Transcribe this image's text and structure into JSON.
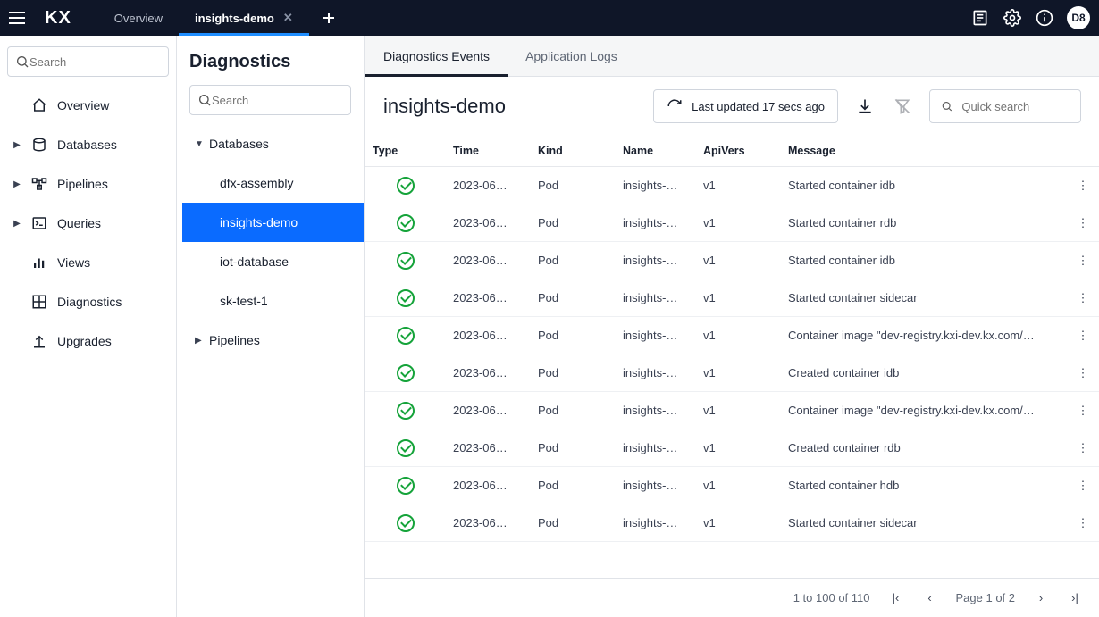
{
  "nav": {
    "logo": "KX",
    "tabs": [
      {
        "label": "Overview",
        "active": false,
        "closable": false
      },
      {
        "label": "insights-demo",
        "active": true,
        "closable": true
      }
    ],
    "avatar": "D8"
  },
  "sidebar": {
    "search_placeholder": "Search",
    "items": [
      {
        "label": "Overview",
        "icon": "home",
        "expandable": false
      },
      {
        "label": "Databases",
        "icon": "disk",
        "expandable": true
      },
      {
        "label": "Pipelines",
        "icon": "flow",
        "expandable": true
      },
      {
        "label": "Queries",
        "icon": "terminal",
        "expandable": true
      },
      {
        "label": "Views",
        "icon": "chart",
        "expandable": false
      },
      {
        "label": "Diagnostics",
        "icon": "grid",
        "expandable": false
      },
      {
        "label": "Upgrades",
        "icon": "upload",
        "expandable": false
      }
    ]
  },
  "panel": {
    "title": "Diagnostics",
    "search_placeholder": "Search",
    "tree": [
      {
        "label": "Databases",
        "type": "group",
        "expanded": true
      },
      {
        "label": "dfx-assembly",
        "type": "child"
      },
      {
        "label": "insights-demo",
        "type": "child",
        "selected": true
      },
      {
        "label": "iot-database",
        "type": "child"
      },
      {
        "label": "sk-test-1",
        "type": "child"
      },
      {
        "label": "Pipelines",
        "type": "group",
        "expanded": false
      }
    ]
  },
  "content": {
    "subtabs": [
      {
        "label": "Diagnostics Events",
        "active": true
      },
      {
        "label": "Application Logs",
        "active": false
      }
    ],
    "title": "insights-demo",
    "refresh_label": "Last updated 17 secs ago",
    "quicksearch_placeholder": "Quick search",
    "columns": [
      "Type",
      "Time",
      "Kind",
      "Name",
      "ApiVers",
      "Message"
    ],
    "rows": [
      {
        "time": "2023-06…",
        "kind": "Pod",
        "name": "insights-…",
        "api": "v1",
        "msg": "Started container idb"
      },
      {
        "time": "2023-06…",
        "kind": "Pod",
        "name": "insights-…",
        "api": "v1",
        "msg": "Started container rdb"
      },
      {
        "time": "2023-06…",
        "kind": "Pod",
        "name": "insights-…",
        "api": "v1",
        "msg": "Started container idb"
      },
      {
        "time": "2023-06…",
        "kind": "Pod",
        "name": "insights-…",
        "api": "v1",
        "msg": "Started container sidecar"
      },
      {
        "time": "2023-06…",
        "kind": "Pod",
        "name": "insights-…",
        "api": "v1",
        "msg": "Container image \"dev-registry.kxi-dev.kx.com/…"
      },
      {
        "time": "2023-06…",
        "kind": "Pod",
        "name": "insights-…",
        "api": "v1",
        "msg": "Created container idb"
      },
      {
        "time": "2023-06…",
        "kind": "Pod",
        "name": "insights-…",
        "api": "v1",
        "msg": "Container image \"dev-registry.kxi-dev.kx.com/…"
      },
      {
        "time": "2023-06…",
        "kind": "Pod",
        "name": "insights-…",
        "api": "v1",
        "msg": "Created container rdb"
      },
      {
        "time": "2023-06…",
        "kind": "Pod",
        "name": "insights-…",
        "api": "v1",
        "msg": "Started container hdb"
      },
      {
        "time": "2023-06…",
        "kind": "Pod",
        "name": "insights-…",
        "api": "v1",
        "msg": "Started container sidecar"
      }
    ],
    "pager": {
      "range": "1 to 100 of 110",
      "page": "Page 1 of 2"
    }
  }
}
